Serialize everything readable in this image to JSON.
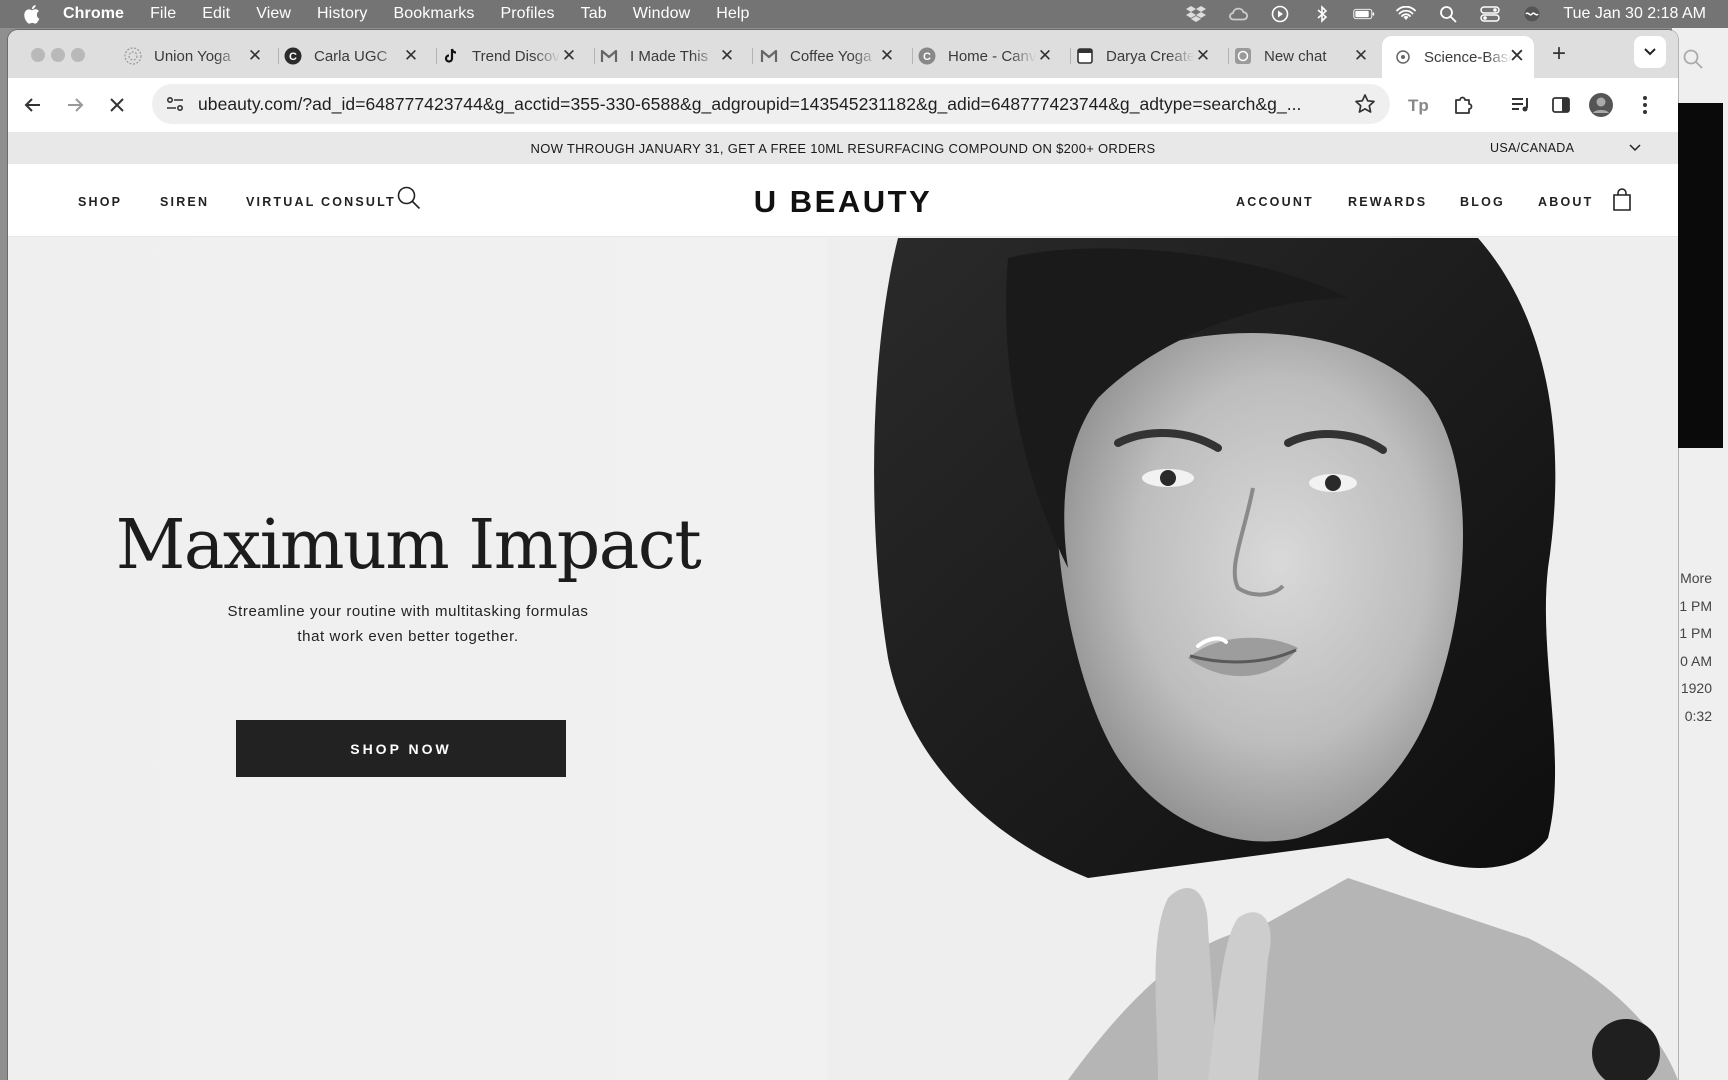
{
  "menubar": {
    "app_name": "Chrome",
    "items": [
      "File",
      "Edit",
      "View",
      "History",
      "Bookmarks",
      "Profiles",
      "Tab",
      "Window",
      "Help"
    ],
    "clock": "Tue Jan 30  2:18 AM",
    "status_icons": [
      "dropbox-icon",
      "creative-cloud-icon",
      "play-icon",
      "bluetooth-icon",
      "battery-icon",
      "wifi-icon",
      "spotlight-search-icon",
      "control-center-icon",
      "siri-icon"
    ]
  },
  "browser": {
    "tabs": [
      {
        "title": "Union Yoga",
        "icon": "union-yoga-favicon"
      },
      {
        "title": "Carla UGC",
        "icon": "canva-favicon"
      },
      {
        "title": "Trend Discovery",
        "icon": "tiktok-favicon"
      },
      {
        "title": "I Made This",
        "icon": "gmail-favicon"
      },
      {
        "title": "Coffee Yoga",
        "icon": "gmail-favicon"
      },
      {
        "title": "Home - Canva",
        "icon": "canva-favicon"
      },
      {
        "title": "Darya Creates",
        "icon": "notion-favicon"
      },
      {
        "title": "New chat",
        "icon": "chatgpt-favicon"
      },
      {
        "title": "Science-Based",
        "icon": "ubeauty-favicon",
        "active": true
      }
    ],
    "url": "ubeauty.com/?ad_id=648777423744&g_acctid=355-330-6588&g_adgroupid=143545231182&g_adid=648777423744&g_adtype=search&g_..."
  },
  "page": {
    "announcement": "NOW THROUGH JANUARY 31, GET A FREE 10ML RESURFACING COMPOUND ON $200+ ORDERS",
    "region": "USA/CANADA",
    "nav_left": [
      "SHOP",
      "SIREN",
      "VIRTUAL CONSULT"
    ],
    "logo": "U BEAUTY",
    "nav_right": [
      "ACCOUNT",
      "REWARDS",
      "BLOG",
      "ABOUT"
    ],
    "hero": {
      "title": "Maximum Impact",
      "subtitle_line1": "Streamline your routine with multitasking formulas",
      "subtitle_line2": "that work even better together.",
      "cta": "SHOP NOW"
    }
  },
  "background_window": {
    "labels": [
      "More",
      "1 PM",
      "1 PM",
      "0 AM",
      "1920",
      "0:32",
      "..."
    ]
  },
  "colors": {
    "menubar": "#747474",
    "tabstrip": "#dedede",
    "cta_background": "#222222",
    "hero_background": "#efefef"
  }
}
